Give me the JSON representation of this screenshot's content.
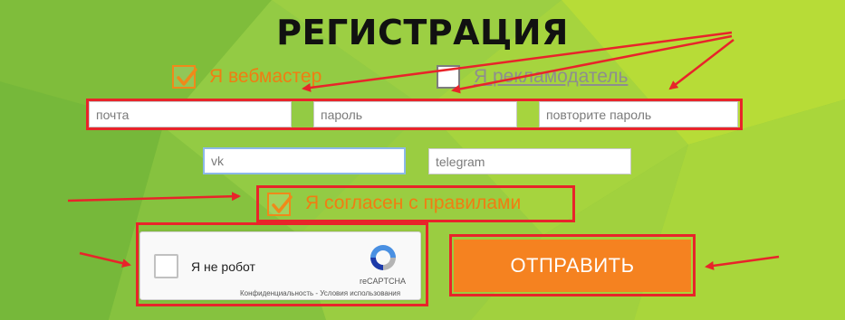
{
  "colors": {
    "background": "#8cc63f",
    "accent_orange": "#f58220",
    "annotation_red": "#e8242a"
  },
  "title": "РЕГИСТРАЦИЯ",
  "role_options": {
    "webmaster": {
      "label": "Я вебмастер",
      "checked": true
    },
    "advertiser": {
      "label": "Я рекламодатель",
      "checked": false
    }
  },
  "fields": {
    "email_placeholder": "почта",
    "password_placeholder": "пароль",
    "repeat_password_placeholder": "повторите пароль",
    "vk_placeholder": "vk",
    "telegram_placeholder": "telegram"
  },
  "agree": {
    "label": "Я согласен с правилами",
    "checked": true
  },
  "recaptcha": {
    "label": "Я не робот",
    "brand": "reCAPTCHA",
    "links": "Конфиденциальность - Условия использования",
    "icon": "recaptcha-logo-icon"
  },
  "submit_label": "ОТПРАВИТЬ",
  "icons": {
    "check": "check-icon",
    "arrow": "annotation-arrow"
  }
}
